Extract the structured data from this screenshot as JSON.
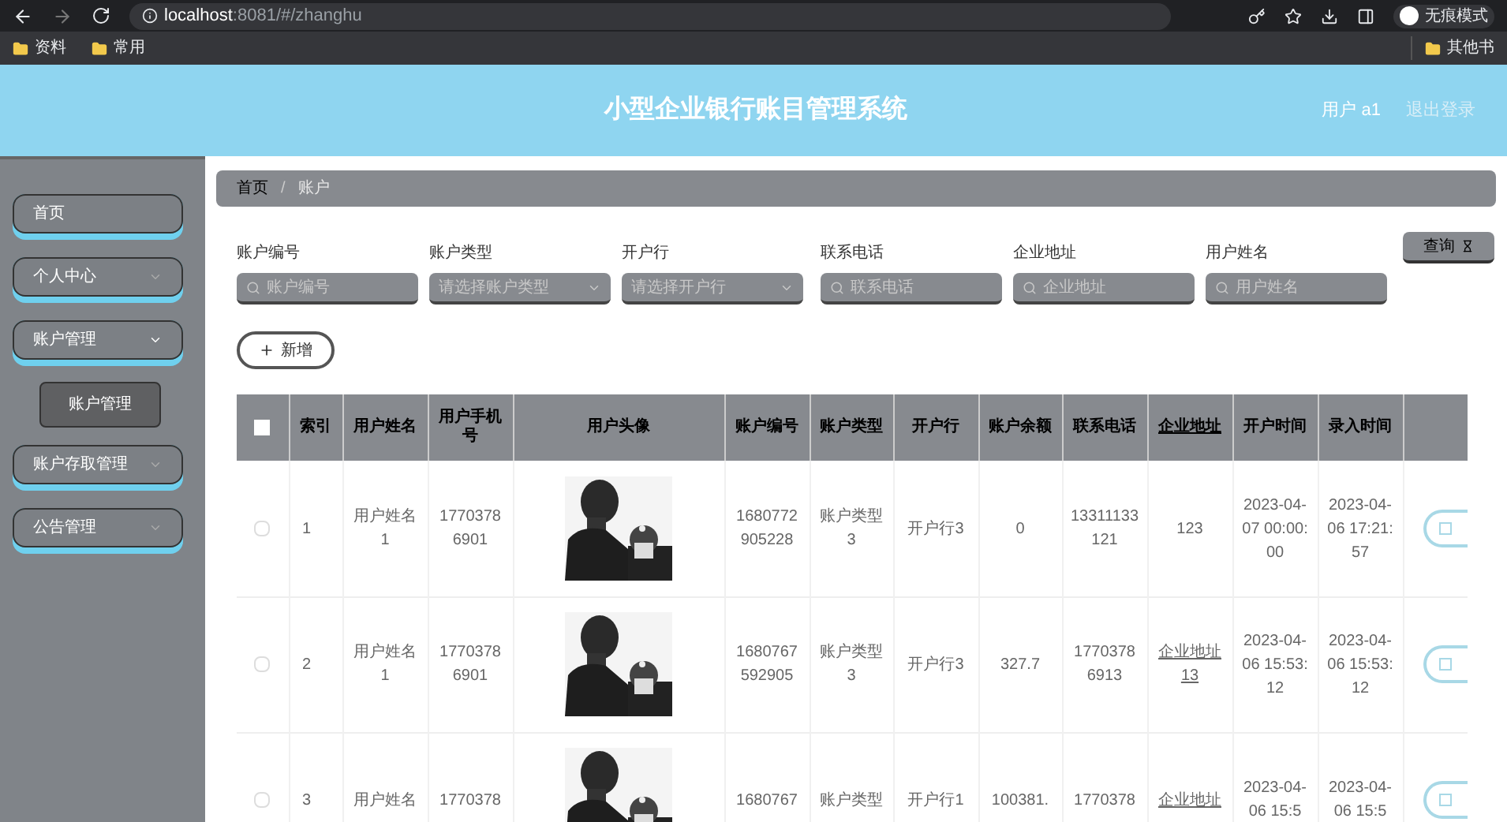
{
  "browser": {
    "url_host": "localhost",
    "url_rest": ":8081/#/zhanghu",
    "profile": "无痕模式",
    "bookmarks": [
      "资料",
      "常用"
    ],
    "other_bookmarks": "其他书"
  },
  "header": {
    "title": "小型企业银行账目管理系统",
    "user": "用户 a1",
    "logout": "退出登录"
  },
  "sidebar": {
    "items": [
      {
        "label": "首页",
        "kind": "link"
      },
      {
        "label": "个人中心",
        "kind": "menu",
        "expanded": false
      },
      {
        "label": "账户管理",
        "kind": "menu",
        "expanded": true,
        "children": [
          {
            "label": "账户管理",
            "selected": true
          }
        ]
      },
      {
        "label": "账户存取管理",
        "kind": "menu",
        "expanded": false
      },
      {
        "label": "公告管理",
        "kind": "menu",
        "expanded": false
      }
    ]
  },
  "breadcrumb": {
    "items": [
      "首页",
      "账户"
    ],
    "separator": "/"
  },
  "filters": [
    {
      "label": "账户编号",
      "placeholder": "账户编号",
      "kind": "search"
    },
    {
      "label": "账户类型",
      "placeholder": "请选择账户类型",
      "kind": "select"
    },
    {
      "label": "开户行",
      "placeholder": "请选择开户行",
      "kind": "select"
    },
    {
      "label": "联系电话",
      "placeholder": "联系电话",
      "kind": "search"
    },
    {
      "label": "企业地址",
      "placeholder": "企业地址",
      "kind": "search"
    },
    {
      "label": "用户姓名",
      "placeholder": "用户姓名",
      "kind": "search"
    }
  ],
  "search_button": "查询",
  "add_button": "新增",
  "table": {
    "all_checked": false,
    "columns": [
      "索引",
      "用户姓名",
      "用户手机号",
      "用户头像",
      "账户编号",
      "账户类型",
      "开户行",
      "账户余额",
      "联系电话",
      "企业地址",
      "开户时间",
      "录入时间"
    ],
    "rows": [
      {
        "checked": false,
        "cells": [
          "1",
          "用户姓名1",
          "17703786901",
          {
            "kind": "picture"
          },
          "1680772905228",
          "账户类型3",
          "开户行3",
          "0",
          "13311133121",
          "123",
          "2023-04-07 00:00:00",
          "2023-04-06 17:21:57"
        ]
      },
      {
        "checked": false,
        "cells": [
          "2",
          "用户姓名1",
          "17703786901",
          {
            "kind": "picture"
          },
          "1680767592905",
          "账户类型3",
          "开户行3",
          "327.7",
          "17703786913",
          "企业地址13",
          "2023-04-06 15:53:12",
          "2023-04-06 15:53:12"
        ]
      },
      {
        "checked": false,
        "cells": [
          "3",
          "用户姓名",
          "1770378",
          {
            "kind": "picture"
          },
          "1680767",
          "账户类型",
          "开户行1",
          "100381.",
          "1770378",
          "企业地址",
          "2023-04-06 15:5",
          "2023-04-06 15:5"
        ]
      }
    ]
  }
}
